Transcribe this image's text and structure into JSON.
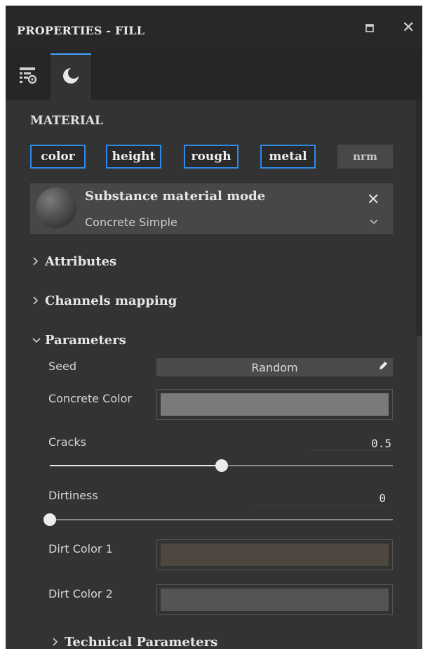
{
  "window": {
    "title": "PROPERTIES - FILL",
    "restore_icon": "restore-icon",
    "close_glyph": "✕"
  },
  "tabs": [
    {
      "name": "layer-settings",
      "icon": "layer-settings-icon",
      "active": false
    },
    {
      "name": "material",
      "icon": "moon-sphere-icon",
      "active": true
    }
  ],
  "material": {
    "section_title": "MATERIAL",
    "channels": [
      {
        "label": "color",
        "enabled": true
      },
      {
        "label": "height",
        "enabled": true
      },
      {
        "label": "rough",
        "enabled": true
      },
      {
        "label": "metal",
        "enabled": true
      },
      {
        "label": "nrm",
        "enabled": false
      }
    ],
    "mode_title": "Substance material mode",
    "material_name": "Concrete Simple",
    "close_glyph": "✕",
    "dropdown_glyph": "⌄"
  },
  "groups": {
    "attributes": {
      "label": "Attributes",
      "expanded": false,
      "chevron": "›"
    },
    "channels_mapping": {
      "label": "Channels mapping",
      "expanded": false,
      "chevron": "›"
    },
    "parameters": {
      "label": "Parameters",
      "expanded": true,
      "chevron": "⌄"
    },
    "technical": {
      "label": "Technical Parameters",
      "expanded": false,
      "chevron": "›"
    }
  },
  "parameters": {
    "seed": {
      "label": "Seed",
      "value": "Random",
      "edit_icon": "pencil-icon"
    },
    "concrete_color": {
      "label": "Concrete Color",
      "color": "#7a7a7a"
    },
    "cracks": {
      "label": "Cracks",
      "value": "0.5",
      "fraction": 0.5
    },
    "dirtiness": {
      "label": "Dirtiness",
      "value": "0",
      "fraction": 0.0
    },
    "dirt_color_1": {
      "label": "Dirt Color 1",
      "color": "#4e473f"
    },
    "dirt_color_2": {
      "label": "Dirt Color 2",
      "color": "#545454"
    }
  },
  "colors": {
    "accent": "#2d8ae8",
    "panel_bg": "#333333"
  }
}
